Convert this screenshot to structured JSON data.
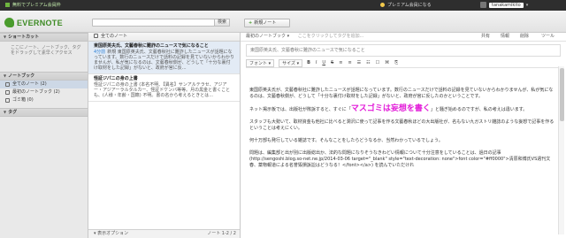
{
  "topbar": {
    "promo": "無料でプレミアム会員枠",
    "center": "プレミアム会員になる",
    "account": "tanakamikito"
  },
  "header": {
    "logo": "EVERNOTE",
    "search_placeholder": "",
    "search_button": "検索",
    "new_note": "新規ノート"
  },
  "sidebar": {
    "shortcuts_title": "ショートカット",
    "shortcuts_hint": "ここにノート、ノートブック、タグをドラッグして素早くアクセス",
    "notebooks_title": "ノートブック",
    "notebooks": [
      {
        "label": "全てのノート (2)"
      },
      {
        "label": "最初のノートブック (2)"
      },
      {
        "label": "ゴミ箱 (0)"
      }
    ],
    "tags_title": "タグ"
  },
  "notelist": {
    "header": "全てのノート",
    "notes": [
      {
        "title": "東国原英夫氏、文藝春秋に難詐のニュースで気になること",
        "date": "4分前",
        "excerpt": "新規 東国原英夫氏、文藝春秋社に難詐したニュースが話題になっています。数行のニュースだけで話料の記録を見ていないからわかりませんが、私が気になるのは、文藝春秋側が、どうして「十分な裏付け取材をした記録」がないと、政府が官に反..."
      },
      {
        "title": "怪証ジパニの身の上書",
        "date": "",
        "excerpt": "怪証ジパニの身の上書 (本名不明、【異名】サンアルテラセ、アジアー・アジアーラルタルカー、怪証ドケンバ等等。月の黒金と書くことも、(人様・年齢・国籍) 不明。書の名から考えるときとは..."
      }
    ],
    "footer_options": "表示オプション",
    "footer_count": "ノート 1-2 / 2"
  },
  "editor": {
    "notebook_select": "最初のノートブック",
    "tag_hint": "ここをクリックしてタグを追加...",
    "share": "共有",
    "info": "情報",
    "delete": "削除",
    "tools": "ツール",
    "title_placeholder": "東国原英夫氏、文藝春秋に難詐のニュースで気になること",
    "toolbar": {
      "font": "フォント",
      "size": "サイズ",
      "bold": "B",
      "italic": "I",
      "underline": "U",
      "strike": "S"
    },
    "paragraphs": [
      "東国原英夫氏が、文藝春秋社に難詐したニュースが話題になっています。数行のニュースだけで話料の記録を見ていないからわかりませんが、私が気になるのは、文藝春秋側が、どうして「十分な裏付け取材をした記録」がないと、政府が官に反したのかということです。",
      "ネット掲示板では、出版社が敗訴すると、すぐに「マスゴミは妄想を書く」と騒ぎ始めるのですが、私の考えは違います。",
      "スタッフも大勢いて、取材資金も他社に比べると潤沢に使って記事を作る文藝春秋ほどの大出版社が、名もない九ガストリ雑誌のような妄想で記事を作るということは考えにくい。",
      "何十万部も発行している雑誌です。そんなことをしたらどうなるか、当然わかっているでしょう。",
      "問題は、編集部と出が別に出版総出か、法的な問題になりそうなきわどい情報について十分注意をしていることは、過日の記事 (http://sengoshi.blog.so-net.ne.jp/2014-03-06 target=\"_blank\" style=\"text-decoration: none\">font color=\"#ff0000\">清原和博氏VS週刊文春、薬物報道による名誉毀損訴訟はどうなる！</font></a>) を読んでいただけれ"
    ],
    "highlight": "マスゴミは妄想を書く"
  }
}
